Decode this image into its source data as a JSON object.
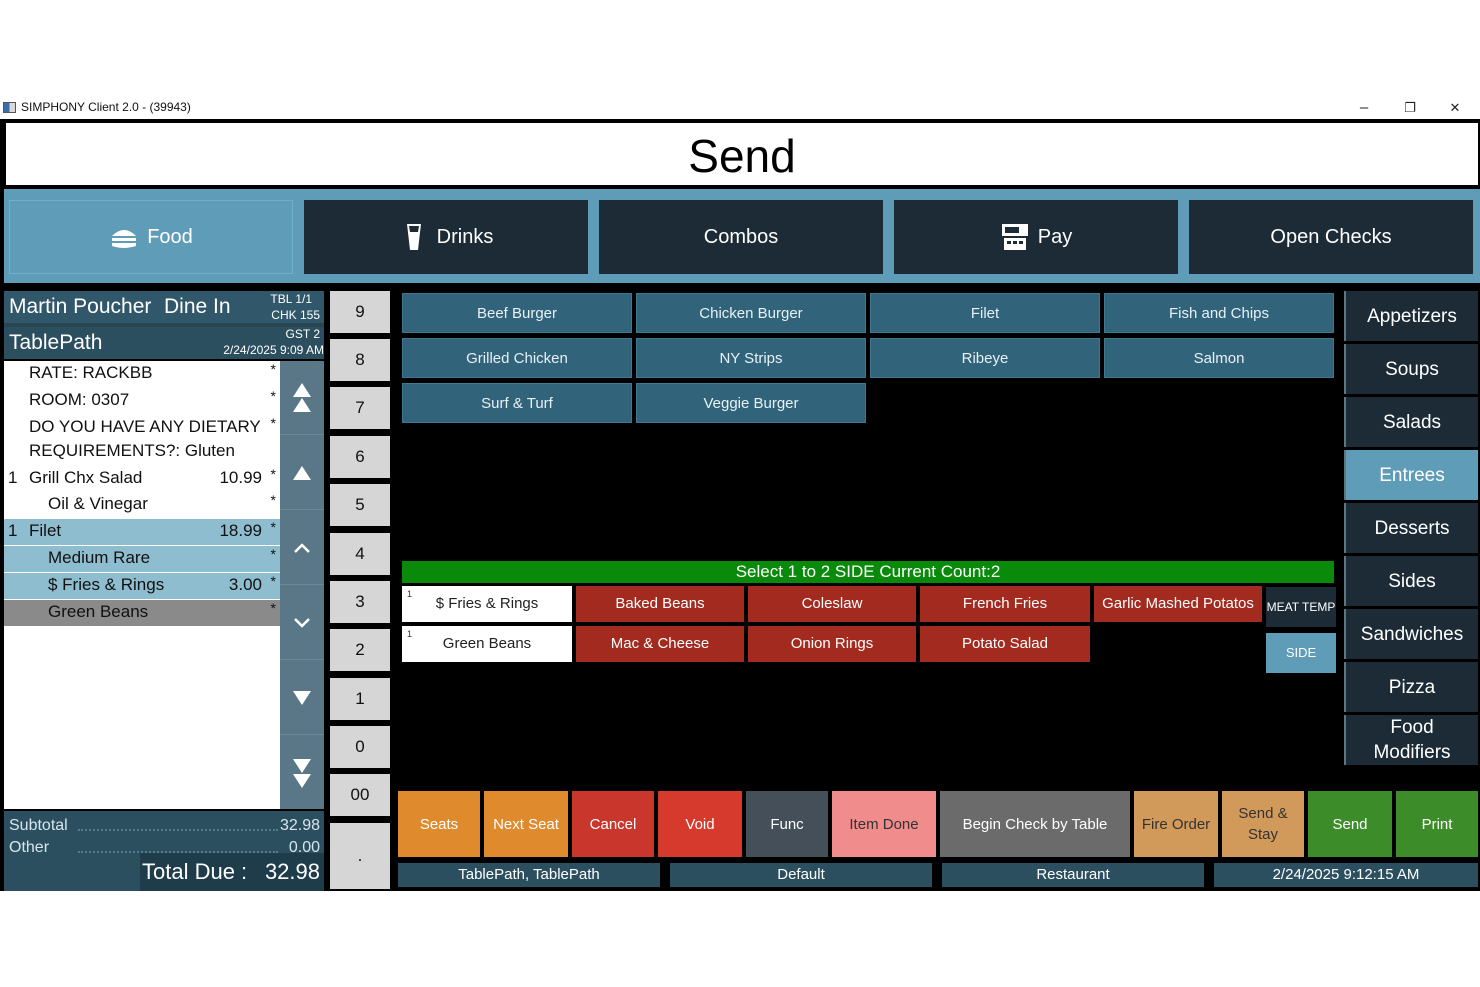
{
  "window": {
    "title": "SIMPHONY Client 2.0 - (39943)",
    "minimize": "–",
    "restore": "❐",
    "close": "✕"
  },
  "banner": "Send",
  "nav": [
    {
      "label": "Food",
      "icon": "burger-icon"
    },
    {
      "label": "Drinks",
      "icon": "glass-icon"
    },
    {
      "label": "Combos"
    },
    {
      "label": "Pay",
      "icon": "register-icon"
    },
    {
      "label": "Open Checks"
    }
  ],
  "check": {
    "employee": "Martin Poucher",
    "order_type": "Dine In",
    "table": "TBL 1/1",
    "check_no": "CHK 155",
    "revenue_center": "TablePath",
    "guests": "GST 2",
    "datetime": "2/24/2025 9:09 AM",
    "lines": [
      {
        "qty": "",
        "name": "RATE: RACKBB",
        "price": "",
        "star": "*"
      },
      {
        "qty": "",
        "name": "ROOM: 0307",
        "price": "",
        "star": "*"
      },
      {
        "qty": "",
        "name": "DO YOU HAVE ANY DIETARY",
        "price": "",
        "star": "*"
      },
      {
        "qty": "",
        "name": "REQUIREMENTS?: Gluten",
        "price": "",
        "star": ""
      },
      {
        "qty": "1",
        "name": "Grill Chx Salad",
        "price": "10.99",
        "star": "*"
      },
      {
        "qty": "",
        "name": "Oil & Vinegar",
        "price": "",
        "star": "*"
      },
      {
        "qty": "1",
        "name": "Filet",
        "price": "18.99",
        "star": "*"
      },
      {
        "qty": "",
        "name": "Medium Rare",
        "price": "",
        "star": "*"
      },
      {
        "qty": "",
        "name": "$ Fries & Rings",
        "price": "3.00",
        "star": "*"
      },
      {
        "qty": "",
        "name": "Green Beans",
        "price": "",
        "star": "*"
      }
    ],
    "subtotal_label": "Subtotal",
    "subtotal": "32.98",
    "other_label": "Other",
    "other": "0.00",
    "total_label": "Total Due :",
    "total": "32.98"
  },
  "numpad": [
    "9",
    "8",
    "7",
    "6",
    "5",
    "4",
    "3",
    "2",
    "1",
    "0",
    "00",
    "."
  ],
  "menu_items": [
    "Beef Burger",
    "Chicken Burger",
    "Filet",
    "Fish and Chips",
    "Grilled Chicken",
    "NY Strips",
    "Ribeye",
    "Salmon",
    "Surf & Turf",
    "Veggie Burger"
  ],
  "categories": [
    "Appetizers",
    "Soups",
    "Salads",
    "Entrees",
    "Desserts",
    "Sides",
    "Sandwiches",
    "Pizza",
    "Food Modifiers"
  ],
  "active_category": "Entrees",
  "prompt": "Select 1 to 2 SIDE Current Count:2",
  "sides_selected": [
    {
      "count": "1",
      "name": "$ Fries & Rings"
    },
    {
      "count": "1",
      "name": "Green Beans"
    }
  ],
  "sides": [
    "Baked Beans",
    "Coleslaw",
    "French Fries",
    "Garlic Mashed Potatos",
    "Mac & Cheese",
    "Onion Rings",
    "Potato Salad"
  ],
  "mod_tabs": {
    "meat_temp": "MEAT TEMP",
    "side": "SIDE"
  },
  "functions": [
    {
      "label": "Seats",
      "color": "#e08a2e"
    },
    {
      "label": "Next Seat",
      "color": "#e08a2e"
    },
    {
      "label": "Cancel",
      "color": "#c9372c"
    },
    {
      "label": "Void",
      "color": "#d63a2c"
    },
    {
      "label": "Func",
      "color": "#444f59"
    },
    {
      "label": "Item Done",
      "color": "#f08c8c"
    },
    {
      "label": "Begin Check by Table",
      "color": "#6b6b6b"
    },
    {
      "label": "Fire Order",
      "color": "#d19a5a"
    },
    {
      "label": "Send & Stay",
      "color": "#d19a5a"
    },
    {
      "label": "Send",
      "color": "#3d8c2a"
    },
    {
      "label": "Print",
      "color": "#3d8c2a"
    }
  ],
  "footer": [
    "TablePath, TablePath",
    "Default",
    "Restaurant",
    "2/24/2025 9:12:15 AM"
  ]
}
